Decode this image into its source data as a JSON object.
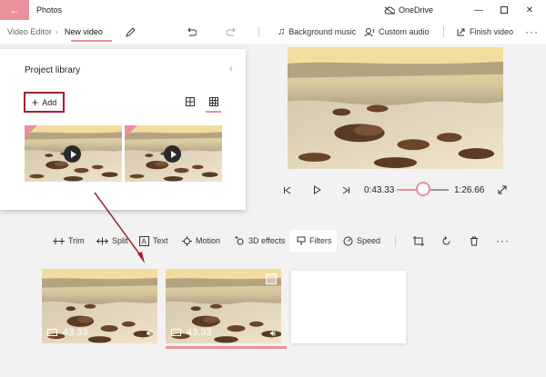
{
  "titlebar": {
    "app_title": "Photos",
    "onedrive_label": "OneDrive"
  },
  "toolbar": {
    "crumb_root": "Video Editor",
    "crumb_current": "New video",
    "background_music": "Background music",
    "custom_audio": "Custom audio",
    "finish_video": "Finish video"
  },
  "library": {
    "title": "Project library",
    "add_label": "Add"
  },
  "player": {
    "current_time": "0:43.33",
    "total_time": "1:26.66",
    "progress": 0.5
  },
  "storyboard_toolbar": {
    "trim": "Trim",
    "split": "Split",
    "text": "Text",
    "motion": "Motion",
    "effects_3d": "3D effects",
    "filters": "Filters",
    "speed": "Speed"
  },
  "storyboard": {
    "cards": [
      {
        "duration": "43.33"
      },
      {
        "duration": "43.33"
      }
    ]
  },
  "colors": {
    "accent": "#e8919b",
    "highlight_border": "#a0232f"
  }
}
